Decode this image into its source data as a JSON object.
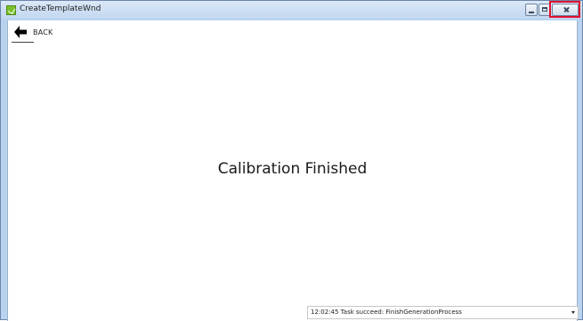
{
  "window": {
    "title": "CreateTemplateWnd",
    "highlight_color": "#e0112e"
  },
  "toolbar": {
    "back_label": "BACK",
    "back_icon": "arrow-left-icon"
  },
  "main": {
    "message": "Calibration Finished"
  },
  "status": {
    "text": "12:02:45 Task succeed: FinishGenerationProcess"
  }
}
